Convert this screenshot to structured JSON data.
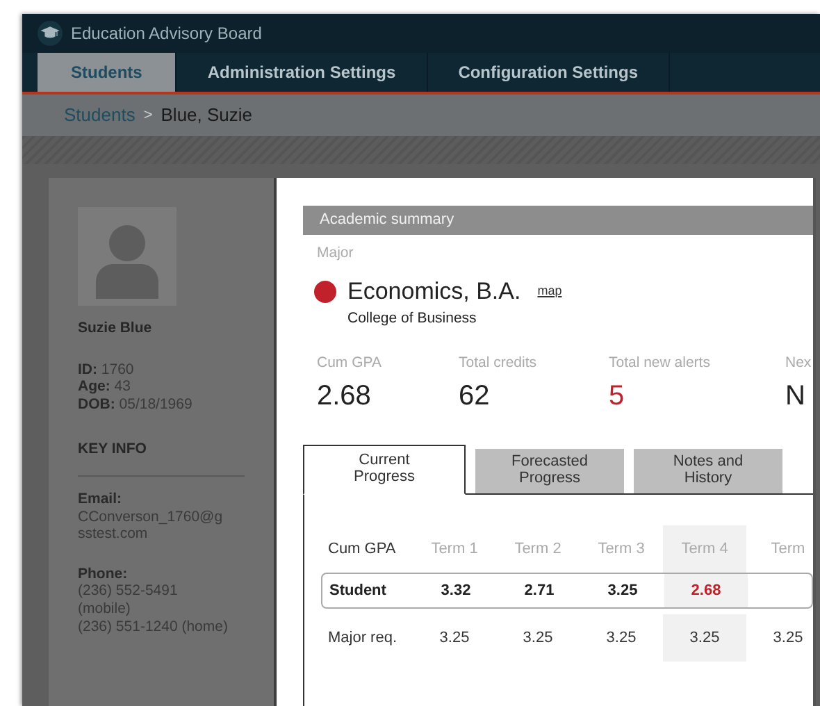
{
  "app_title": "Education Advisory Board",
  "nav_tabs": [
    {
      "label": "Students",
      "selected": true
    },
    {
      "label": "Administration Settings",
      "selected": false
    },
    {
      "label": "Configuration Settings",
      "selected": false
    }
  ],
  "breadcrumb": [
    {
      "label": "Students",
      "kind": "link"
    },
    {
      "label": ">",
      "kind": "separator"
    },
    {
      "label": "Blue, Suzie",
      "kind": "current"
    }
  ],
  "profile": {
    "name": "Suzie Blue",
    "facts": [
      {
        "label": "ID:",
        "value": "1760"
      },
      {
        "label": "Age:",
        "value": "43"
      },
      {
        "label": "DOB:",
        "value": "05/18/1969"
      }
    ],
    "section_heading": "KEY INFO",
    "contacts": [
      {
        "label": "Email:",
        "lines": [
          "CConverson_1760@g",
          "sstest.com"
        ]
      },
      {
        "label": "Phone:",
        "lines": [
          "(236) 552-5491",
          "(mobile)",
          "(236) 551-1240 (home)"
        ]
      }
    ]
  },
  "summary": {
    "title": "Academic summary",
    "major_label": "Major",
    "major": {
      "name": "Economics, B.A.",
      "color": "#c0212b",
      "link": "map",
      "college": "College of Business"
    },
    "stats": [
      {
        "label": "Cum GPA",
        "value": "2.68",
        "alert": false
      },
      {
        "label": "Total credits",
        "value": "62",
        "alert": false
      },
      {
        "label": "Total new alerts",
        "value": "5",
        "alert": true
      },
      {
        "label": "Nex",
        "value": "N",
        "alert": false
      }
    ]
  },
  "progress_tabs": [
    {
      "label": "Current Progress",
      "selected": true
    },
    {
      "label": "Forecasted Progress",
      "selected": false
    },
    {
      "label": "Notes and History",
      "selected": false
    }
  ],
  "table": {
    "corner_label": "Cum GPA",
    "columns": [
      {
        "label": "Term 1",
        "highlighted": false
      },
      {
        "label": "Term 2",
        "highlighted": false
      },
      {
        "label": "Term 3",
        "highlighted": false
      },
      {
        "label": "Term 4",
        "highlighted": true
      },
      {
        "label": "Term",
        "highlighted": false
      }
    ],
    "rows": [
      {
        "label": "Student",
        "kind": "student",
        "cells": [
          {
            "value": "3.32",
            "alert": false
          },
          {
            "value": "2.71",
            "alert": false
          },
          {
            "value": "3.25",
            "alert": false
          },
          {
            "value": "2.68",
            "alert": true
          }
        ]
      },
      {
        "label": "Major req.",
        "kind": "normal",
        "cells": [
          {
            "value": "3.25",
            "alert": false
          },
          {
            "value": "3.25",
            "alert": false
          },
          {
            "value": "3.25",
            "alert": false
          },
          {
            "value": "3.25",
            "alert": false
          },
          {
            "value": "3.25",
            "alert": false
          }
        ]
      }
    ]
  }
}
